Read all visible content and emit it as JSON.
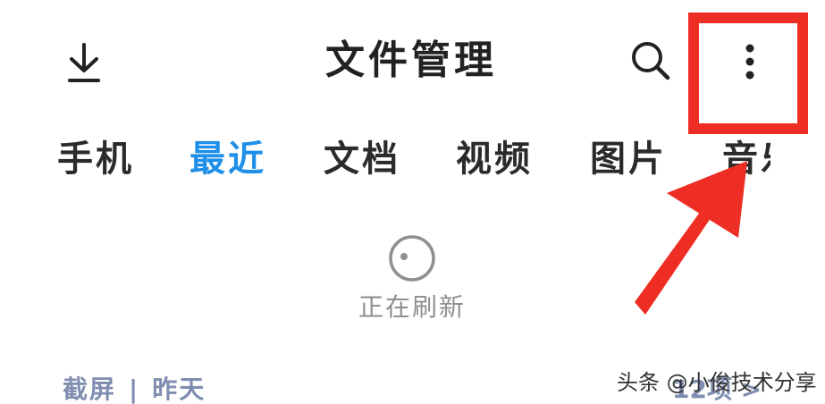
{
  "header": {
    "title": "文件管理"
  },
  "tabs": [
    {
      "label": "手机",
      "active": false
    },
    {
      "label": "最近",
      "active": true
    },
    {
      "label": "文档",
      "active": false
    },
    {
      "label": "视频",
      "active": false
    },
    {
      "label": "图片",
      "active": false
    },
    {
      "label": "音乐",
      "active": false
    }
  ],
  "status": {
    "refresh_text": "正在刷新"
  },
  "section": {
    "name": "截屏",
    "separator": "|",
    "date": "昨天",
    "count": "12项 >"
  },
  "watermark": {
    "text": "头条 @小俊技术分享"
  },
  "colors": {
    "active_tab": "#1f8fe8",
    "annotation": "#ee2d24",
    "section_text": "#7f8db0"
  },
  "icons": {
    "download": "download-icon",
    "search": "search-icon",
    "more": "more-vertical-icon",
    "refresh": "refresh-icon"
  }
}
